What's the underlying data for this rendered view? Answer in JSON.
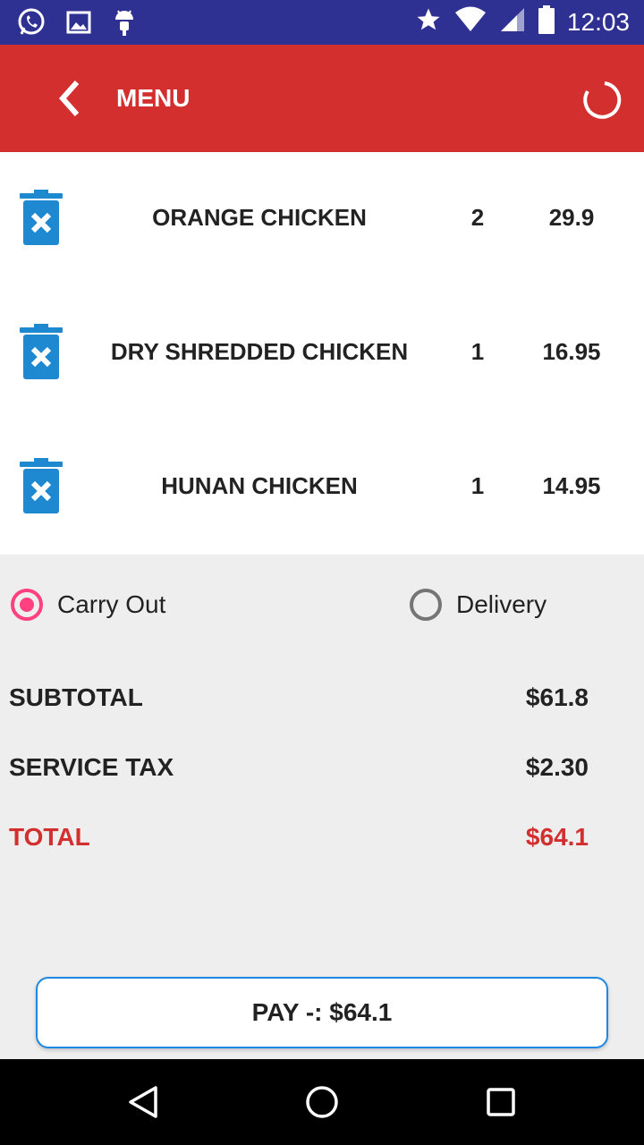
{
  "status_bar": {
    "time": "12:03",
    "left_icons": [
      "whatsapp-icon",
      "gallery-icon",
      "android-icon"
    ],
    "right_icons": [
      "star-icon",
      "wifi-icon",
      "signal-icon",
      "battery-icon"
    ]
  },
  "toolbar": {
    "title": "MENU",
    "back_icon": "chevron-left-icon",
    "refresh_icon": "refresh-icon"
  },
  "orders": [
    {
      "name": "ORANGE CHICKEN",
      "qty": "2",
      "price": "29.9"
    },
    {
      "name": "DRY SHREDDED CHICKEN",
      "qty": "1",
      "price": "16.95"
    },
    {
      "name": "HUNAN CHICKEN",
      "qty": "1",
      "price": "14.95"
    }
  ],
  "order_type": {
    "options": [
      {
        "label": "Carry Out",
        "selected": true
      },
      {
        "label": "Delivery",
        "selected": false
      }
    ]
  },
  "summary": {
    "subtotal_label": "SUBTOTAL",
    "subtotal_value": "$61.8",
    "tax_label": "SERVICE TAX",
    "tax_value": "$2.30",
    "total_label": "TOTAL",
    "total_value": "$64.1"
  },
  "pay_button": {
    "label": "PAY -: $64.1"
  },
  "colors": {
    "status_bar": "#2e3192",
    "toolbar": "#d32f2f",
    "accent_pink": "#ff4081",
    "trash_blue": "#1e88d0",
    "total_red": "#d32f2f",
    "pay_border": "#1e88e5"
  }
}
